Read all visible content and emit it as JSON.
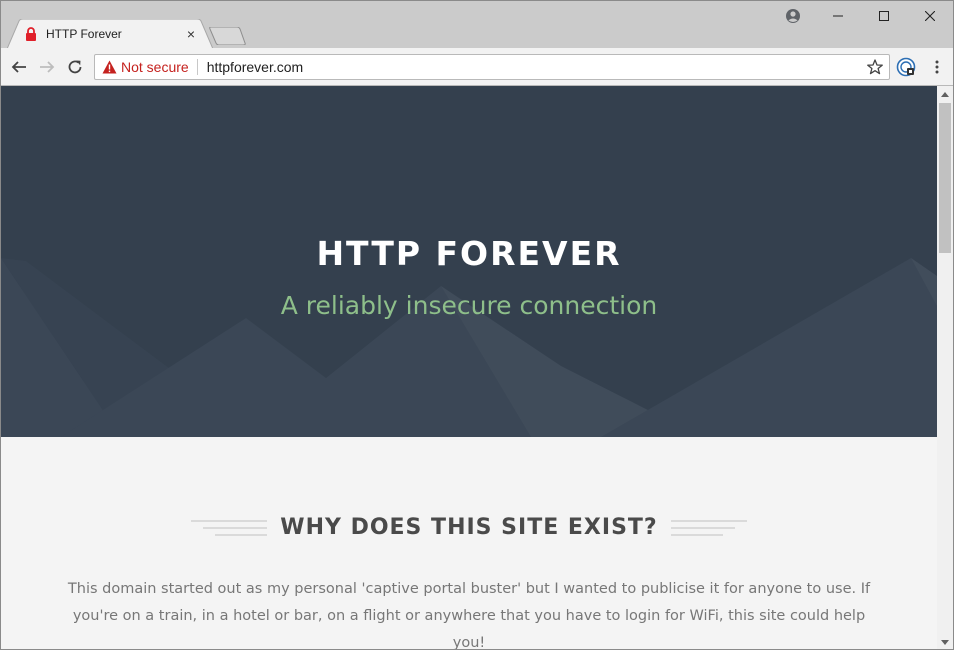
{
  "browser": {
    "tab": {
      "title": "HTTP Forever",
      "close_glyph": "×",
      "icon": "lock-icon"
    },
    "window_controls": {
      "minimize_glyph": "—",
      "maximize_glyph": "☐",
      "close_glyph": "✕"
    },
    "omnibox": {
      "security_label": "Not secure",
      "url": "httpforever.com"
    },
    "colors": {
      "warning_red": "#c5221f",
      "hero_bg": "#34404e",
      "hero_subtitle": "#8ebf8a"
    }
  },
  "page": {
    "hero": {
      "title": "HTTP FOREVER",
      "subtitle": "A reliably insecure connection"
    },
    "section": {
      "heading": "WHY DOES THIS SITE EXIST?",
      "body": "This domain started out as my personal 'captive portal buster' but I wanted to publicise it for anyone to use. If you're on a train, in a hotel or bar, on a flight or anywhere that you have to login for WiFi, this site could help you!"
    }
  }
}
